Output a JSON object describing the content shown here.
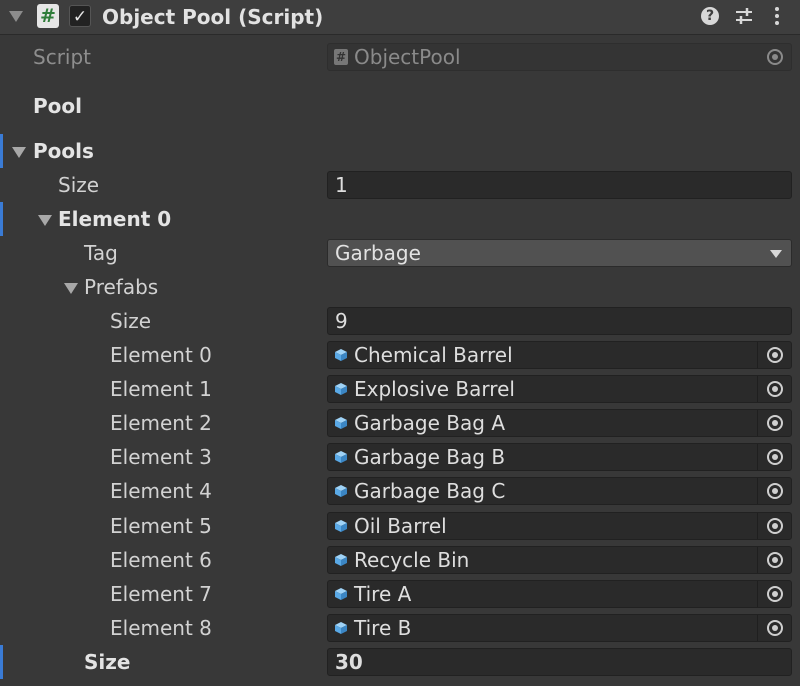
{
  "header": {
    "script_icon": "script-hash-icon",
    "enabled": true,
    "title": "Object Pool (Script)",
    "help_icon": "help-icon",
    "preset_icon": "preset-sliders-icon",
    "menu_icon": "kebab-menu-icon"
  },
  "script_field": {
    "label": "Script",
    "value": "ObjectPool"
  },
  "section_title": "Pool",
  "pools": {
    "label": "Pools",
    "size_label": "Size",
    "size_value": "1",
    "element": {
      "label": "Element 0",
      "tag_label": "Tag",
      "tag_value": "Garbage",
      "prefabs": {
        "label": "Prefabs",
        "size_label": "Size",
        "size_value": "9",
        "items": [
          {
            "label": "Element 0",
            "value": "Chemical Barrel"
          },
          {
            "label": "Element 1",
            "value": "Explosive Barrel"
          },
          {
            "label": "Element 2",
            "value": "Garbage Bag A"
          },
          {
            "label": "Element 3",
            "value": "Garbage Bag B"
          },
          {
            "label": "Element 4",
            "value": "Garbage Bag C"
          },
          {
            "label": "Element 5",
            "value": "Oil Barrel"
          },
          {
            "label": "Element 6",
            "value": "Recycle Bin"
          },
          {
            "label": "Element 7",
            "value": "Tire A"
          },
          {
            "label": "Element 8",
            "value": "Tire B"
          }
        ]
      },
      "size_label": "Size",
      "size_value": "30"
    }
  },
  "colors": {
    "background": "#383838",
    "field": "#2a2a2a",
    "accent": "#3a7bd5",
    "prefab_icon": "#5aa9e6"
  }
}
